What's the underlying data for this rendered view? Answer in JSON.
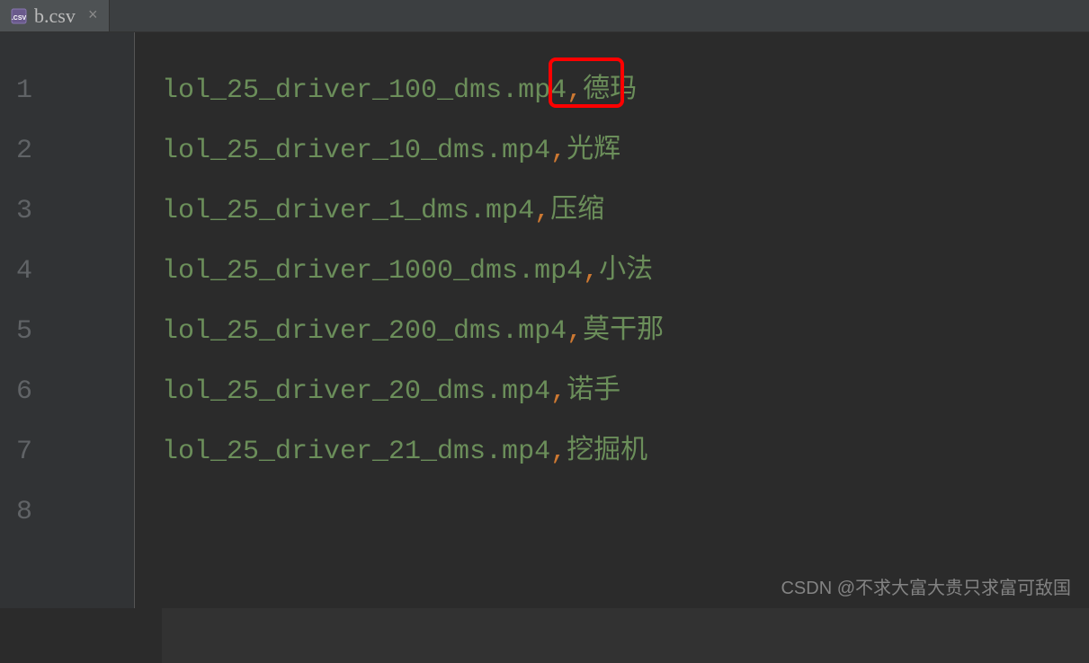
{
  "tab": {
    "filename": "b.csv",
    "icon_name": "csv-file-icon"
  },
  "editor": {
    "line_numbers": [
      "1",
      "2",
      "3",
      "4",
      "5",
      "6",
      "7",
      "8"
    ],
    "lines": [
      {
        "parts": [
          {
            "text": "lol_25_driver_",
            "type": "normal"
          },
          {
            "text": "100",
            "type": "highlighted"
          },
          {
            "text": "_dms.mp4",
            "type": "normal"
          },
          {
            "text": ",",
            "type": "comma"
          },
          {
            "text": "德玛",
            "type": "chinese"
          }
        ]
      },
      {
        "parts": [
          {
            "text": "lol_25_driver_10_dms.mp4",
            "type": "normal"
          },
          {
            "text": ",",
            "type": "comma"
          },
          {
            "text": "光辉",
            "type": "chinese"
          }
        ]
      },
      {
        "parts": [
          {
            "text": "lol_25_driver_1_dms.mp4",
            "type": "normal"
          },
          {
            "text": ",",
            "type": "comma"
          },
          {
            "text": "压缩",
            "type": "chinese"
          }
        ]
      },
      {
        "parts": [
          {
            "text": "lol_25_driver_1000_dms.mp4",
            "type": "normal"
          },
          {
            "text": ",",
            "type": "comma"
          },
          {
            "text": "小法",
            "type": "chinese"
          }
        ]
      },
      {
        "parts": [
          {
            "text": "lol_25_driver_200_dms.mp4",
            "type": "normal"
          },
          {
            "text": ",",
            "type": "comma"
          },
          {
            "text": "莫干那",
            "type": "chinese"
          }
        ]
      },
      {
        "parts": [
          {
            "text": "lol_25_driver_20_dms.mp4",
            "type": "normal"
          },
          {
            "text": ",",
            "type": "comma"
          },
          {
            "text": "诺手",
            "type": "chinese"
          }
        ]
      },
      {
        "parts": [
          {
            "text": "lol_25_driver_21_dms.mp4",
            "type": "normal"
          },
          {
            "text": ",",
            "type": "comma"
          },
          {
            "text": "挖掘机",
            "type": "chinese"
          }
        ]
      },
      {
        "parts": []
      }
    ]
  },
  "watermark": "CSDN @不求大富大贵只求富可敌国",
  "highlight": {
    "line": 1,
    "text": "100"
  }
}
